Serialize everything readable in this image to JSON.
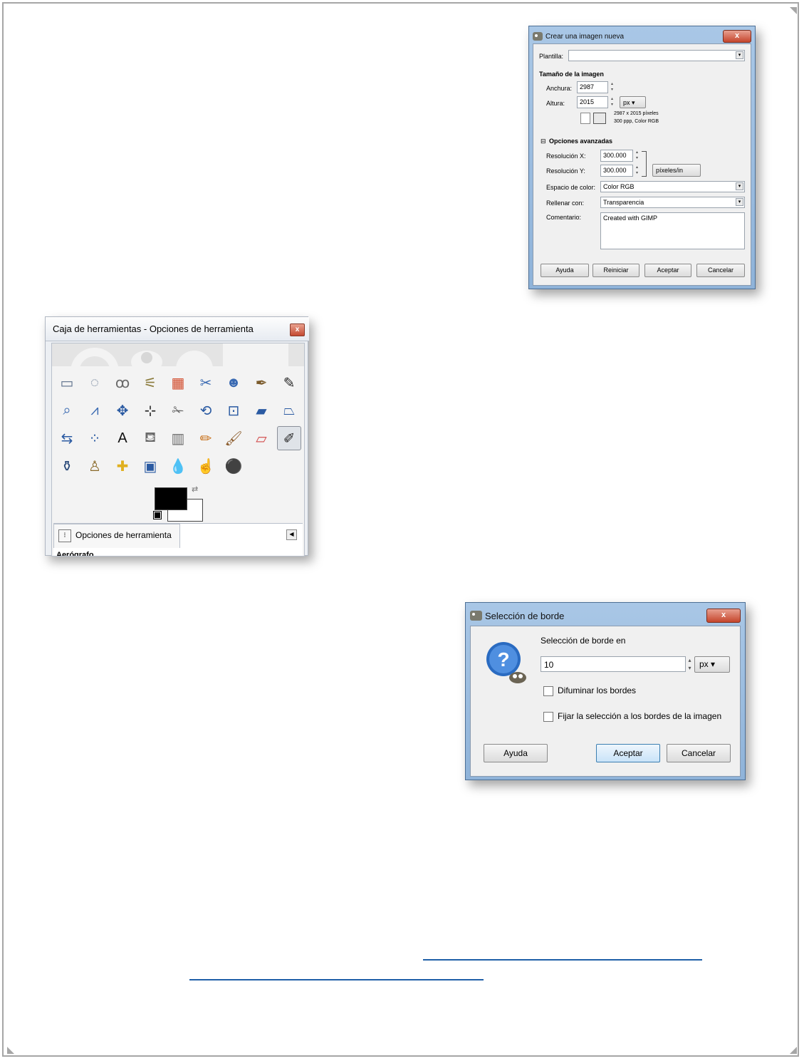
{
  "new_image_dialog": {
    "title": "Crear una imagen nueva",
    "template_label": "Plantilla:",
    "template_value": "",
    "image_size_heading": "Tamaño de la imagen",
    "width_label": "Anchura:",
    "width_value": "2987",
    "height_label": "Altura:",
    "height_value": "2015",
    "unit": "px",
    "info_line1": "2987 x 2015 píxeles",
    "info_line2": "300 ppp, Color RGB",
    "advanced_heading": "Opciones avanzadas",
    "res_x_label": "Resolución X:",
    "res_x_value": "300.000",
    "res_y_label": "Resolución Y:",
    "res_y_value": "300.000",
    "res_unit": "píxeles/in",
    "colorspace_label": "Espacio de color:",
    "colorspace_value": "Color RGB",
    "fill_label": "Rellenar con:",
    "fill_value": "Transparencia",
    "comment_label": "Comentario:",
    "comment_value": "Created with GIMP",
    "buttons": {
      "help": "Ayuda",
      "reset": "Reiniciar",
      "accept": "Aceptar",
      "cancel": "Cancelar"
    }
  },
  "toolbox": {
    "title": "Caja de herramientas - Opciones de herramienta",
    "close": "x",
    "options_tab": "Opciones de herramienta",
    "options_content": "Aerógrafo",
    "tools": [
      {
        "name": "rect-select-tool",
        "glyph": "▭",
        "color": "#5a6e8a"
      },
      {
        "name": "ellipse-select-tool",
        "glyph": "◌",
        "color": "#5a6e8a"
      },
      {
        "name": "free-select-tool",
        "glyph": "ꝏ",
        "color": "#6a6a6a"
      },
      {
        "name": "fuzzy-select-tool",
        "glyph": "⚟",
        "color": "#8a7a3a"
      },
      {
        "name": "select-by-color-tool",
        "glyph": "▦",
        "color": "#d24a2a"
      },
      {
        "name": "scissors-tool",
        "glyph": "✂",
        "color": "#3a6ab2"
      },
      {
        "name": "foreground-select-tool",
        "glyph": "☻",
        "color": "#3a6ab2"
      },
      {
        "name": "paths-tool",
        "glyph": "✒",
        "color": "#7a5a2a"
      },
      {
        "name": "color-picker-tool",
        "glyph": "✎",
        "color": "#2a2a2a"
      },
      {
        "name": "zoom-tool",
        "glyph": "⌕",
        "color": "#3a6ab2"
      },
      {
        "name": "measure-tool",
        "glyph": "⩘",
        "color": "#3a6ab2"
      },
      {
        "name": "move-tool",
        "glyph": "✥",
        "color": "#2a5aa2"
      },
      {
        "name": "align-tool",
        "glyph": "⊹",
        "color": "#2a2a2a"
      },
      {
        "name": "crop-tool",
        "glyph": "✁",
        "color": "#6a6a6a"
      },
      {
        "name": "rotate-tool",
        "glyph": "⟲",
        "color": "#2a5aa2"
      },
      {
        "name": "scale-tool",
        "glyph": "⊡",
        "color": "#2a5aa2"
      },
      {
        "name": "shear-tool",
        "glyph": "▰",
        "color": "#2a5aa2"
      },
      {
        "name": "perspective-tool",
        "glyph": "⏢",
        "color": "#2a5aa2"
      },
      {
        "name": "flip-tool",
        "glyph": "⇆",
        "color": "#2a5aa2"
      },
      {
        "name": "cage-transform-tool",
        "glyph": "⁘",
        "color": "#2a5aa2"
      },
      {
        "name": "text-tool",
        "glyph": "A",
        "color": "#111111"
      },
      {
        "name": "bucket-fill-tool",
        "glyph": "⛾",
        "color": "#6a6a6a"
      },
      {
        "name": "blend-tool",
        "glyph": "▥",
        "color": "#6a6a6a"
      },
      {
        "name": "pencil-tool",
        "glyph": "✏",
        "color": "#c8701a"
      },
      {
        "name": "paintbrush-tool",
        "glyph": "🖌",
        "color": "#8a5a2a"
      },
      {
        "name": "eraser-tool",
        "glyph": "▱",
        "color": "#d24a4a"
      },
      {
        "name": "airbrush-tool",
        "glyph": "✐",
        "color": "#2a2a2a"
      },
      {
        "name": "ink-tool",
        "glyph": "⚱",
        "color": "#2a4a7a"
      },
      {
        "name": "clone-tool",
        "glyph": "♙",
        "color": "#8a6a2a"
      },
      {
        "name": "heal-tool",
        "glyph": "✚",
        "color": "#e0b020"
      },
      {
        "name": "perspective-clone-tool",
        "glyph": "▣",
        "color": "#2a5aa2"
      },
      {
        "name": "blur-sharpen-tool",
        "glyph": "💧",
        "color": "#3a7ac2"
      },
      {
        "name": "smudge-tool",
        "glyph": "☝",
        "color": "#b07a4a"
      },
      {
        "name": "dodge-burn-tool",
        "glyph": "⚫",
        "color": "#333333"
      }
    ]
  },
  "border_dialog": {
    "title": "Selección de borde",
    "close": "x",
    "prompt": "Selección de borde en",
    "value": "10",
    "unit": "px",
    "feather_label": "Difuminar los bordes",
    "clamp_label": "Fijar la selección a los bordes de la imagen",
    "buttons": {
      "help": "Ayuda",
      "accept": "Aceptar",
      "cancel": "Cancelar"
    }
  },
  "links": {
    "line1": "",
    "line2": ""
  }
}
